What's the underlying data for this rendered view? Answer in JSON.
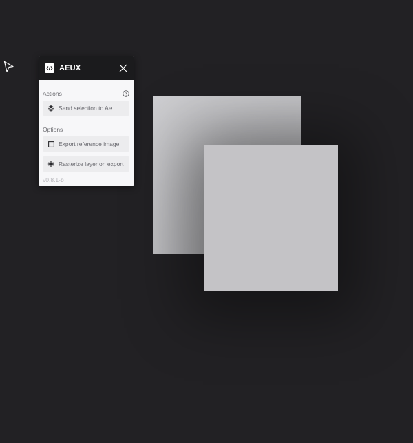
{
  "panel": {
    "title": "AEUX",
    "actions_label": "Actions",
    "send_button_label": "Send selection to Ae",
    "options_label": "Options",
    "export_reference_label": "Export reference image",
    "export_reference_checked": false,
    "rasterize_label": "Rasterize layer on export",
    "version": "v0.8.1-b"
  },
  "colors": {
    "canvas_bg": "#222124",
    "panel_bg": "#f7f7f9",
    "header_bg": "#1b1b1d",
    "button_bg": "#ececee",
    "rect_front": "#c4c3c6",
    "rect_back": "#c6c6c9"
  },
  "icons": {
    "cursor": "arrow-cursor-icon",
    "logo": "code-brackets-icon",
    "close": "close-icon",
    "help": "help-circle-icon",
    "send": "layers-icon",
    "checkbox": "checkbox-icon",
    "rasterize": "asterisk-icon"
  }
}
